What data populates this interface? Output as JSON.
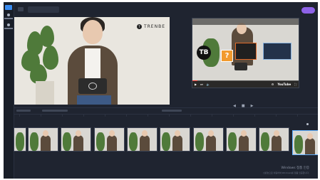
{
  "app": {
    "title_chip": "",
    "export_label": "",
    "brand_name": "TRENBE",
    "brand_mark": "T"
  },
  "rail": {
    "home_label": "",
    "items": [
      "",
      "",
      "",
      ""
    ]
  },
  "video_preview": {
    "top_text": "",
    "logo_text": "TB",
    "question_mark": "?",
    "controls": {
      "play_icon": "play-icon",
      "next_icon": "next-icon",
      "volume_icon": "volume-icon",
      "time": "",
      "youtube": "YouTube"
    },
    "progress": 0.05
  },
  "playback_controls": [
    "◀",
    "■",
    "▶"
  ],
  "timeline": {
    "clip_count": 10
  },
  "watermark": {
    "line1": "Windows 정품 인증",
    "line2": "[설정]으로 이동하여 Windows를 정품 인증합니다."
  },
  "colors": {
    "accent": "#8e63e8",
    "selection": "#5fb0ff",
    "background": "#1f2430"
  }
}
